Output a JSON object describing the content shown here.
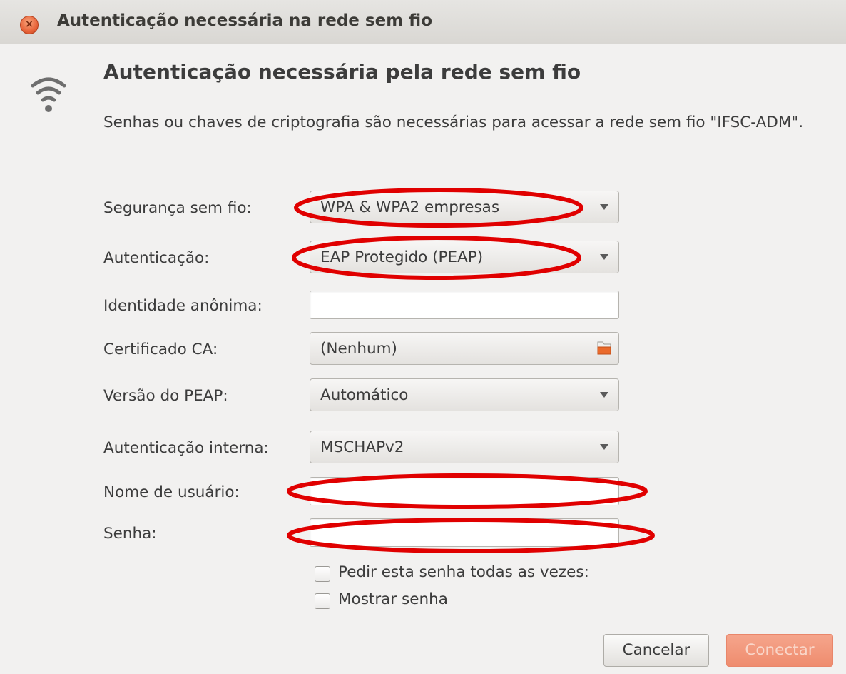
{
  "window": {
    "title": "Autenticação necessária na rede sem fio",
    "close_glyph": "×"
  },
  "dialog": {
    "heading": "Autenticação necessária pela rede sem fio",
    "description": "Senhas ou chaves de criptografia são necessárias para acessar a rede sem fio \"IFSC-ADM\"."
  },
  "form": {
    "security": {
      "label": "Segurança sem fio:",
      "value": "WPA & WPA2 empresas"
    },
    "authentication": {
      "label": "Autenticação:",
      "value": "EAP Protegido (PEAP)"
    },
    "anonymous_identity": {
      "label": "Identidade anônima:",
      "value": ""
    },
    "ca_certificate": {
      "label": "Certificado CA:",
      "value": "(Nenhum)"
    },
    "peap_version": {
      "label": "Versão do PEAP:",
      "value": "Automático"
    },
    "inner_authentication": {
      "label": "Autenticação interna:",
      "value": "MSCHAPv2"
    },
    "username": {
      "label": "Nome de usuário:",
      "value": ""
    },
    "password": {
      "label": "Senha:",
      "value": ""
    },
    "ask_password_every_time": {
      "label": "Pedir esta senha todas as vezes:",
      "checked": false
    },
    "show_password": {
      "label": "Mostrar senha",
      "checked": false
    }
  },
  "buttons": {
    "cancel": "Cancelar",
    "connect": "Conectar"
  },
  "icons": {
    "wifi": "wifi-icon",
    "close": "close-icon",
    "folder": "folder-icon",
    "dropdown": "chevron-down-icon"
  },
  "colors": {
    "accent": "#e8643a",
    "annotation": "#e00000",
    "connect_button": "#ef8c6e"
  }
}
